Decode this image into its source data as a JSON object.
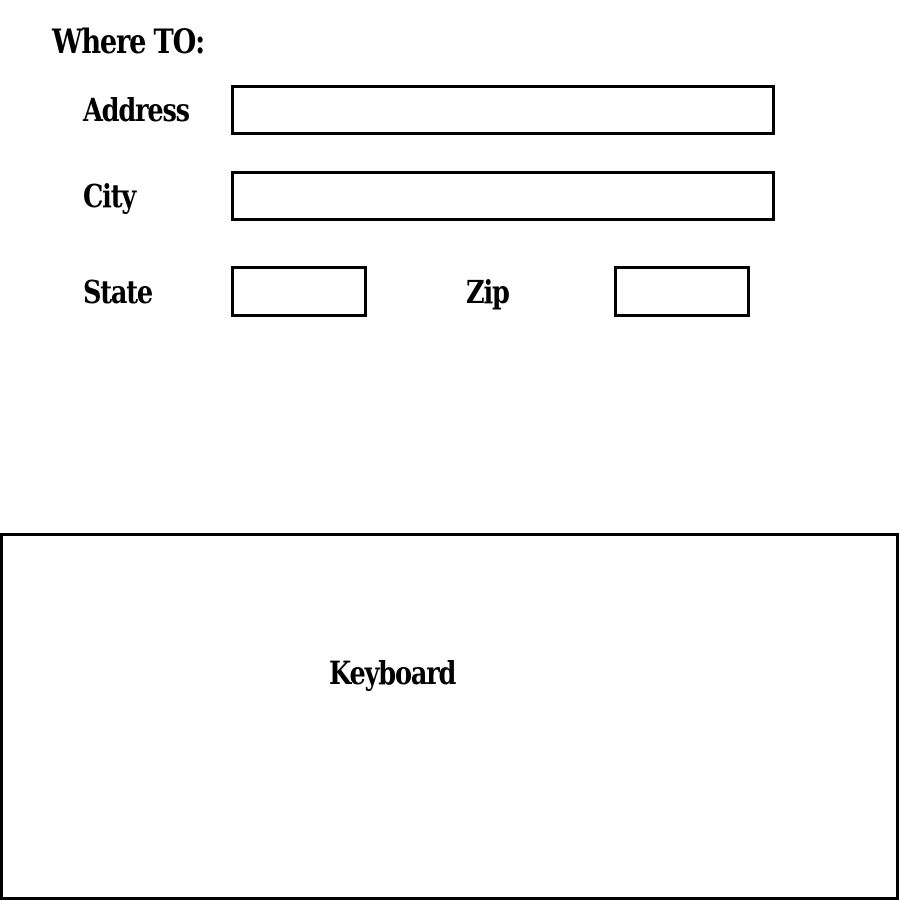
{
  "form": {
    "title": "Where TO:",
    "address": {
      "label": "Address",
      "value": "",
      "placeholder": ""
    },
    "city": {
      "label": "City",
      "value": "",
      "placeholder": ""
    },
    "state": {
      "label": "State",
      "value": "",
      "placeholder": ""
    },
    "zip": {
      "label": "Zip",
      "value": "",
      "placeholder": ""
    }
  },
  "keyboard": {
    "label": "Keyboard"
  }
}
